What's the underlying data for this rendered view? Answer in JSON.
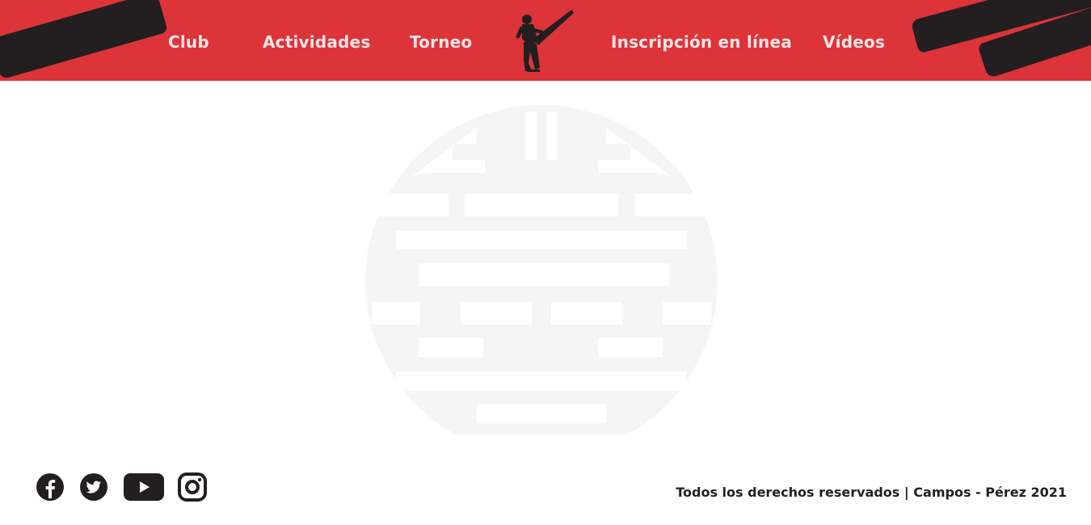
{
  "colors": {
    "header_bg": "#dc3439",
    "nav_text": "#fde5e5",
    "dark": "#231f20",
    "watermark": "#f5f5f5"
  },
  "nav": {
    "items": [
      {
        "label": "Club"
      },
      {
        "label": "Actividades"
      },
      {
        "label": "Torneo"
      },
      {
        "label": "Inscripción en línea"
      },
      {
        "label": "Vídeos"
      }
    ],
    "center_icon": "karate-kick-silhouette-icon"
  },
  "main": {
    "watermark_icon": "chinese-longevity-symbol"
  },
  "footer": {
    "social": [
      {
        "icon": "facebook-icon"
      },
      {
        "icon": "twitter-icon"
      },
      {
        "icon": "youtube-icon"
      },
      {
        "icon": "instagram-icon"
      }
    ],
    "copyright": "Todos los derechos reservados |  Campos - Pérez 2021"
  }
}
